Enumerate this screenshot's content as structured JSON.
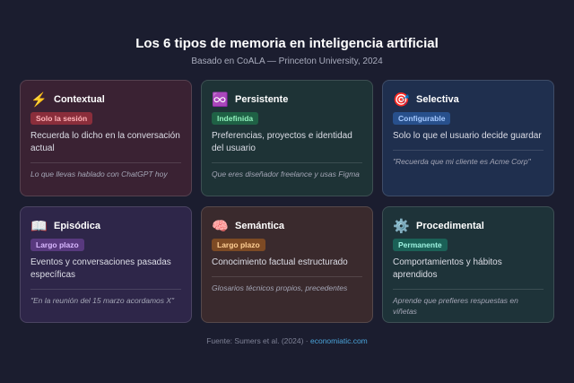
{
  "header": {
    "title": "Los 6 tipos de memoria en inteligencia artificial",
    "subtitle": "Basado en CoALA — Princeton University, 2024"
  },
  "cards": [
    {
      "icon": "⚡",
      "icon_name": "lightning-icon",
      "title": "Contextual",
      "badge": "Solo la sesión",
      "description": "Recuerda lo dicho en la conversación actual",
      "example": "Lo que llevas hablado con ChatGPT hoy"
    },
    {
      "icon": "♾️",
      "icon_name": "infinity-icon",
      "title": "Persistente",
      "badge": "Indefinida",
      "description": "Preferencias, proyectos e identidad del usuario",
      "example": "Que eres diseñador freelance y usas Figma"
    },
    {
      "icon": "🎯",
      "icon_name": "target-icon",
      "title": "Selectiva",
      "badge": "Configurable",
      "description": "Solo lo que el usuario decide guardar",
      "example": "\"Recuerda que mi cliente es Acme Corp\""
    },
    {
      "icon": "📖",
      "icon_name": "open-book-icon",
      "title": "Episódica",
      "badge": "Largo plazo",
      "description": "Eventos y conversaciones pasadas específicas",
      "example": "\"En la reunión del 15 marzo acordamos X\""
    },
    {
      "icon": "🧠",
      "icon_name": "brain-icon",
      "title": "Semántica",
      "badge": "Largo plazo",
      "description": "Conocimiento factual estructurado",
      "example": "Glosarios técnicos propios, precedentes"
    },
    {
      "icon": "⚙️",
      "icon_name": "gear-icon",
      "title": "Procedimental",
      "badge": "Permanente",
      "description": "Comportamientos y hábitos aprendidos",
      "example": "Aprende que prefieres respuestas en viñetas"
    }
  ],
  "footer": {
    "source": "Fuente: Sumers et al. (2024) ·",
    "link": "economiatic.com"
  },
  "colors": {
    "background": "#1b1d2f",
    "link": "#4aa3d9"
  }
}
